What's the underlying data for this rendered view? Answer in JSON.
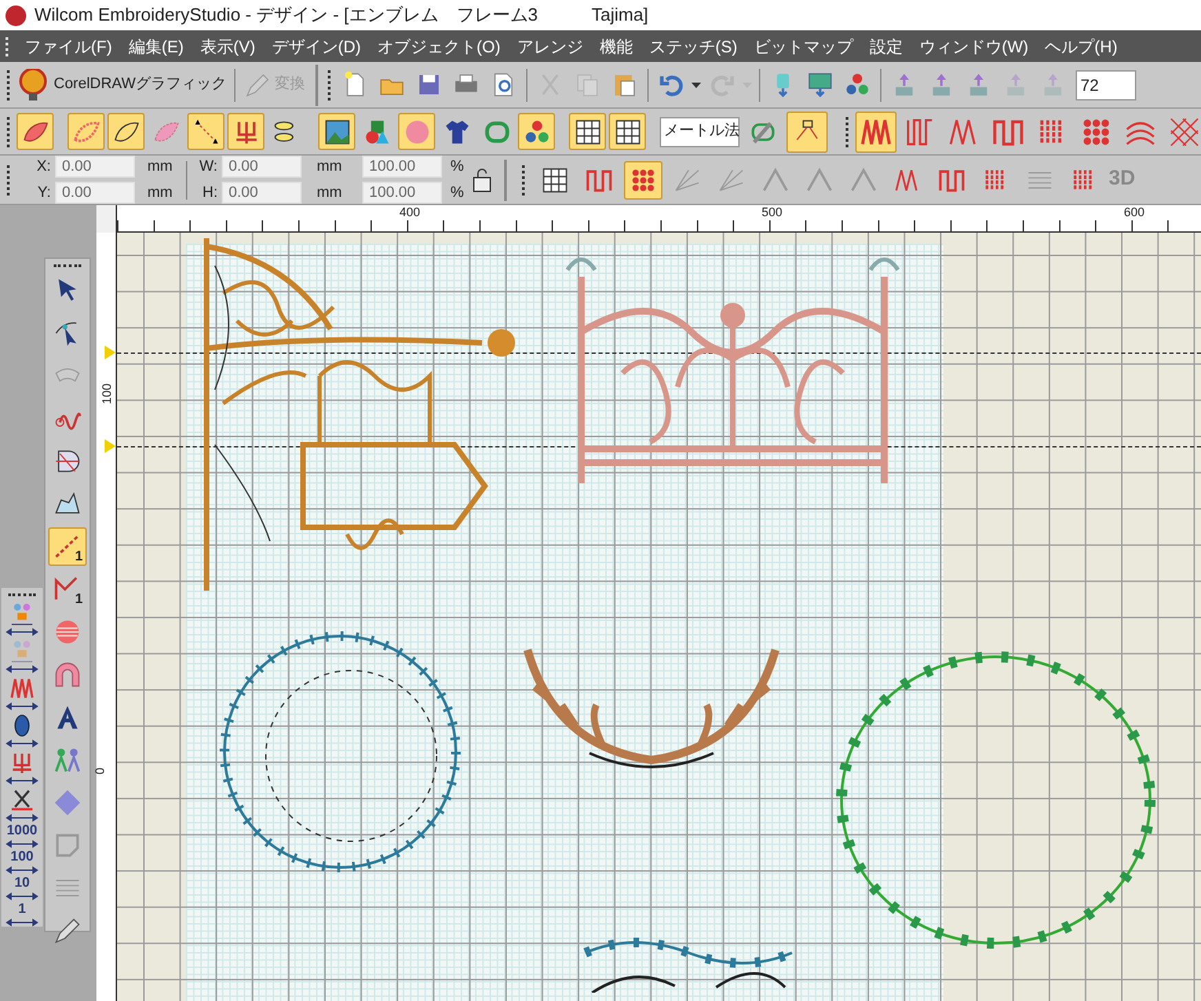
{
  "window": {
    "title": "Wilcom EmbroideryStudio - デザイン - [エンブレム　フレーム3　　　Tajima]"
  },
  "menu": [
    {
      "label": "ファイル(F)"
    },
    {
      "label": "編集(E)"
    },
    {
      "label": "表示(V)"
    },
    {
      "label": "デザイン(D)"
    },
    {
      "label": "オブジェクト(O)"
    },
    {
      "label": "アレンジ"
    },
    {
      "label": "機能"
    },
    {
      "label": "ステッチ(S)"
    },
    {
      "label": "ビットマップ"
    },
    {
      "label": "設定"
    },
    {
      "label": "ウィンドウ(W)"
    },
    {
      "label": "ヘルプ(H)"
    }
  ],
  "standard_toolbar": {
    "corel_button": "CorelDRAWグラフィック",
    "convert_button": {
      "label": "変換",
      "disabled": true
    },
    "tools": [
      {
        "kind": "new",
        "disabled": false
      },
      {
        "kind": "open",
        "disabled": false
      },
      {
        "kind": "save",
        "disabled": false
      },
      {
        "kind": "print",
        "disabled": false
      },
      {
        "kind": "preview",
        "disabled": false
      },
      {
        "kind": "sep"
      },
      {
        "kind": "cut",
        "disabled": true
      },
      {
        "kind": "copy",
        "disabled": true
      },
      {
        "kind": "paste",
        "disabled": false
      },
      {
        "kind": "sep"
      },
      {
        "kind": "undo",
        "disabled": false
      },
      {
        "kind": "caret",
        "disabled": false
      },
      {
        "kind": "redo",
        "disabled": true
      },
      {
        "kind": "caret",
        "disabled": true
      },
      {
        "kind": "sep"
      },
      {
        "kind": "send",
        "disabled": false
      },
      {
        "kind": "screen",
        "disabled": false
      },
      {
        "kind": "balls",
        "disabled": false
      },
      {
        "kind": "sep"
      },
      {
        "kind": "upload",
        "disabled": false
      },
      {
        "kind": "upload",
        "disabled": false
      },
      {
        "kind": "upload",
        "disabled": false
      },
      {
        "kind": "upload",
        "disabled": true
      },
      {
        "kind": "upload",
        "disabled": true
      }
    ],
    "zoom_field": "72"
  },
  "digitize_toolbar": {
    "tools": [
      {
        "kind": "leaf",
        "selected": true
      },
      {
        "kind": "sep"
      },
      {
        "kind": "leaf-fill",
        "selected": true
      },
      {
        "kind": "leaf-outline",
        "selected": true
      },
      {
        "kind": "leaf-dim",
        "selected": false
      },
      {
        "kind": "dotted",
        "selected": true
      },
      {
        "kind": "fork",
        "selected": true
      },
      {
        "kind": "fish",
        "selected": false
      },
      {
        "kind": "sep"
      },
      {
        "kind": "picture",
        "selected": true
      },
      {
        "kind": "shapes",
        "selected": false
      },
      {
        "kind": "pink",
        "selected": true
      },
      {
        "kind": "shirt",
        "selected": false
      },
      {
        "kind": "hoop",
        "selected": false
      },
      {
        "kind": "balls",
        "selected": true
      },
      {
        "kind": "sep"
      },
      {
        "kind": "grid",
        "selected": true
      },
      {
        "kind": "grid",
        "selected": true
      }
    ],
    "units_dropdown": "メートル法",
    "extra_tools": [
      {
        "kind": "wand",
        "selected": false
      },
      {
        "kind": "connect",
        "selected": true
      }
    ]
  },
  "stitch_toolbar": {
    "tools": [
      {
        "kind": "zigzag",
        "selected": true
      },
      {
        "kind": "loop",
        "selected": false
      },
      {
        "kind": "zigzag-thin",
        "selected": false
      },
      {
        "kind": "square",
        "selected": false
      },
      {
        "kind": "dashes",
        "selected": false
      },
      {
        "kind": "dots",
        "selected": false
      },
      {
        "kind": "arcs",
        "selected": false
      },
      {
        "kind": "cross",
        "selected": false
      }
    ]
  },
  "transform_toolbar": {
    "position_fields": [
      {
        "label": "X:",
        "value": "0.00",
        "unit": "mm"
      },
      {
        "label": "Y:",
        "value": "0.00",
        "unit": "mm"
      }
    ],
    "size_fields": [
      {
        "label": "W:",
        "value": "0.00",
        "unit": "mm",
        "scale": "100.00",
        "scale_unit": "%"
      },
      {
        "label": "H:",
        "value": "0.00",
        "unit": "mm",
        "scale": "100.00",
        "scale_unit": "%"
      }
    ]
  },
  "effects_toolbar": {
    "tools": [
      {
        "kind": "grid",
        "selected": false
      },
      {
        "kind": "square",
        "selected": false
      },
      {
        "kind": "dots",
        "selected": true
      },
      {
        "kind": "fan",
        "selected": false
      },
      {
        "kind": "fan",
        "selected": false
      },
      {
        "kind": "peak",
        "selected": false
      },
      {
        "kind": "peak",
        "selected": false
      },
      {
        "kind": "peak",
        "selected": false
      },
      {
        "kind": "zigzag-thin",
        "selected": false
      },
      {
        "kind": "square",
        "selected": false
      },
      {
        "kind": "dashes",
        "selected": false
      },
      {
        "kind": "lines",
        "selected": false
      },
      {
        "kind": "dashes",
        "selected": false
      }
    ],
    "label_3d": "3D"
  },
  "toolbox": [
    {
      "kind": "select",
      "selected": false
    },
    {
      "kind": "reshape",
      "selected": false
    },
    {
      "kind": "arc",
      "selected": false
    },
    {
      "kind": "wave",
      "selected": false
    },
    {
      "kind": "cutd",
      "selected": false
    },
    {
      "kind": "poly",
      "selected": false
    },
    {
      "kind": "line1",
      "selected": true,
      "badge": "1"
    },
    {
      "kind": "corner1",
      "selected": false,
      "badge": "1"
    },
    {
      "kind": "stripeball",
      "selected": false
    },
    {
      "kind": "donut",
      "selected": false
    },
    {
      "kind": "letter",
      "selected": false
    },
    {
      "kind": "people",
      "selected": false
    },
    {
      "kind": "abc",
      "selected": false
    },
    {
      "kind": "corner",
      "selected": false
    },
    {
      "kind": "lines",
      "selected": false
    },
    {
      "kind": "pencil",
      "selected": false
    }
  ],
  "side_tools": [
    {
      "kind": "flowers",
      "disabled": false
    },
    {
      "kind": "flowers",
      "disabled": true
    },
    {
      "kind": "zigzag",
      "disabled": false
    },
    {
      "kind": "spool",
      "disabled": false
    },
    {
      "kind": "fork",
      "disabled": false
    },
    {
      "kind": "scissors",
      "disabled": false
    },
    {
      "kind": "count",
      "label": "1000"
    },
    {
      "kind": "count",
      "label": "100"
    },
    {
      "kind": "count",
      "label": "10"
    },
    {
      "kind": "count",
      "label": "1"
    }
  ],
  "horizontal_ruler": {
    "labels": [
      "400",
      "500",
      "600"
    ]
  },
  "vertical_ruler": {
    "labels": [
      "100",
      "0"
    ]
  },
  "designs": [
    {
      "kind": "sign"
    },
    {
      "kind": "fence"
    },
    {
      "kind": "bead-wreath"
    },
    {
      "kind": "leaf-swag"
    },
    {
      "kind": "vine-wreath"
    },
    {
      "kind": "vine-arc"
    }
  ]
}
